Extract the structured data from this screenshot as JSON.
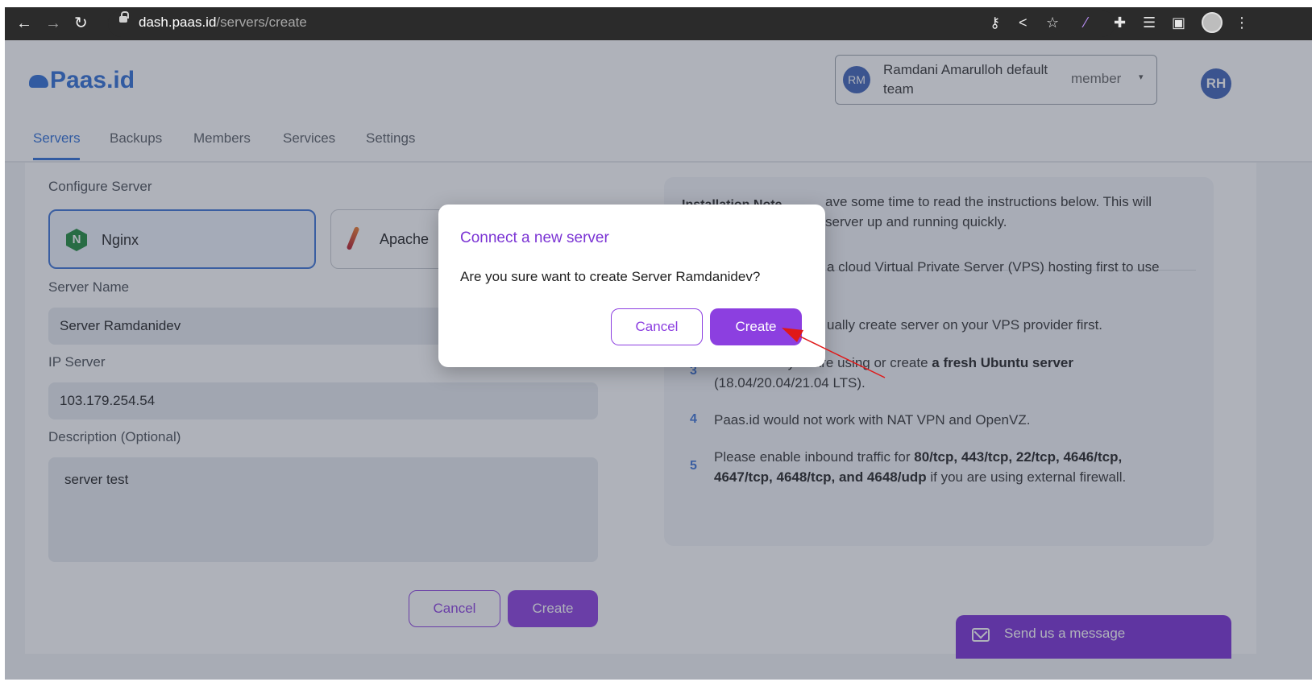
{
  "browser": {
    "url_host": "dash.paas.id",
    "url_path": "/servers/create"
  },
  "header": {
    "logo": "Paas.id",
    "team": {
      "avatar": "RM",
      "name": "Ramdani Amarulloh default team",
      "role": "member"
    },
    "user_avatar": "RH"
  },
  "tabs": [
    {
      "label": "Servers",
      "active": true
    },
    {
      "label": "Backups",
      "active": false
    },
    {
      "label": "Members",
      "active": false
    },
    {
      "label": "Services",
      "active": false
    },
    {
      "label": "Settings",
      "active": false
    }
  ],
  "form": {
    "section_title": "Configure Server",
    "options": [
      {
        "label": "Nginx",
        "selected": true,
        "icon": "nginx-icon"
      },
      {
        "label": "Apache",
        "selected": false,
        "icon": "apache-icon"
      }
    ],
    "server_name_label": "Server Name",
    "server_name_value": "Server Ramdanidev",
    "ip_label": "IP Server",
    "ip_value": "103.179.254.54",
    "description_label": "Description (Optional)",
    "description_value": "server test",
    "cancel_label": "Cancel",
    "create_label": "Create"
  },
  "note": {
    "title": "Installation Note",
    "intro_line1": "ave some time to read the instructions below. This will",
    "intro_line2": "server up and running quickly.",
    "item1_line1": "a cloud Virtual Private Server (VPS) hosting first to use",
    "item2_line1": "ually create server on your VPS provider first.",
    "item3_num": "3",
    "item3_line1_pre": "Ensure that you are using or create ",
    "item3_line1_bold": "a fresh Ubuntu server",
    "item3_line2": "(18.04/20.04/21.04 LTS).",
    "item4_num": "4",
    "item4_text": "Paas.id would not work with NAT VPN and OpenVZ.",
    "item5_num": "5",
    "item5_line1_pre": "Please enable inbound traffic for ",
    "item5_line1_bold": "80/tcp, 443/tcp, 22/tcp, 4646/tcp,",
    "item5_line2_bold": "4647/tcp, 4648/tcp, and 4648/udp",
    "item5_line2_post": " if you are using external firewall."
  },
  "chat": {
    "label": "Send us a message"
  },
  "modal": {
    "title": "Connect a new server",
    "text": "Are you sure want to create Server Ramdanidev?",
    "cancel_label": "Cancel",
    "create_label": "Create"
  },
  "colors": {
    "brand_blue": "#2f6fd6",
    "accent_purple": "#8c3fe0",
    "annotation_red": "#e01818"
  }
}
